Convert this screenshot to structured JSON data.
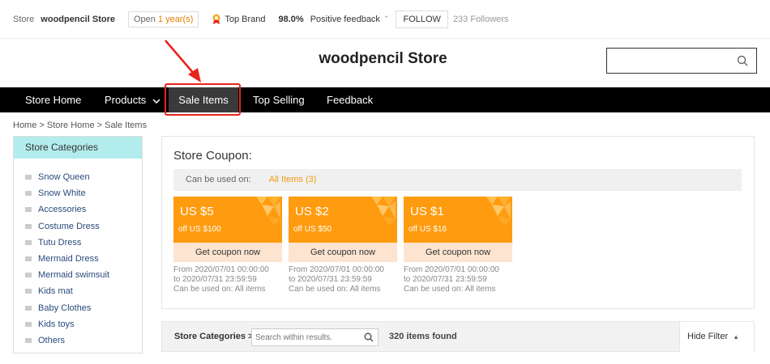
{
  "topbar": {
    "store_label": "Store",
    "store_name": "woodpencil Store",
    "open_prefix": "Open ",
    "open_years": "1 year(s)",
    "brand_label": "Top Brand",
    "feedback_pct": "98.0%",
    "feedback_label": "Positive feedback",
    "follow_label": "FOLLOW",
    "followers": "233 Followers"
  },
  "header": {
    "title": "woodpencil Store",
    "search_placeholder": ""
  },
  "nav": {
    "items": [
      {
        "label": "Store Home"
      },
      {
        "label": "Products"
      },
      {
        "label": "Sale Items"
      },
      {
        "label": "Top Selling"
      },
      {
        "label": "Feedback"
      }
    ],
    "active": "Sale Items"
  },
  "breadcrumb": "Home > Store Home > Sale Items",
  "sidebar": {
    "title": "Store Categories",
    "items": [
      "Snow Queen",
      "Snow White",
      "Accessories",
      "Costume Dress",
      "Tutu Dress",
      "Mermaid Dress",
      "Mermaid swimsuit",
      "Kids mat",
      "Baby Clothes",
      "Kids toys",
      "Others"
    ]
  },
  "coupons": {
    "title": "Store Coupon:",
    "used_on_label": "Can be used on:",
    "all_items": "All Items (3)",
    "items": [
      {
        "amount": "US $5",
        "condition": "off US $100",
        "button": "Get coupon now",
        "from": "From 2020/07/01 00:00:00",
        "to": "to 2020/07/31 23:59:59",
        "usable": "Can be used on: All items"
      },
      {
        "amount": "US $2",
        "condition": "off US $50",
        "button": "Get coupon now",
        "from": "From 2020/07/01 00:00:00",
        "to": "to 2020/07/31 23:59:59",
        "usable": "Can be used on: All items"
      },
      {
        "amount": "US $1",
        "condition": "off US $16",
        "button": "Get coupon now",
        "from": "From 2020/07/01 00:00:00",
        "to": "to 2020/07/31 23:59:59",
        "usable": "Can be used on: All items"
      }
    ]
  },
  "filter": {
    "label": "Store Categories >",
    "search_placeholder": "Search within results.",
    "items_found": "320 items found",
    "hide_filter": "Hide Filter"
  },
  "colors": {
    "accent_orange": "#ff9b0e",
    "nav_bg": "#000000",
    "sidebar_head": "#b3ecec",
    "annotation_red": "#e8231c"
  }
}
